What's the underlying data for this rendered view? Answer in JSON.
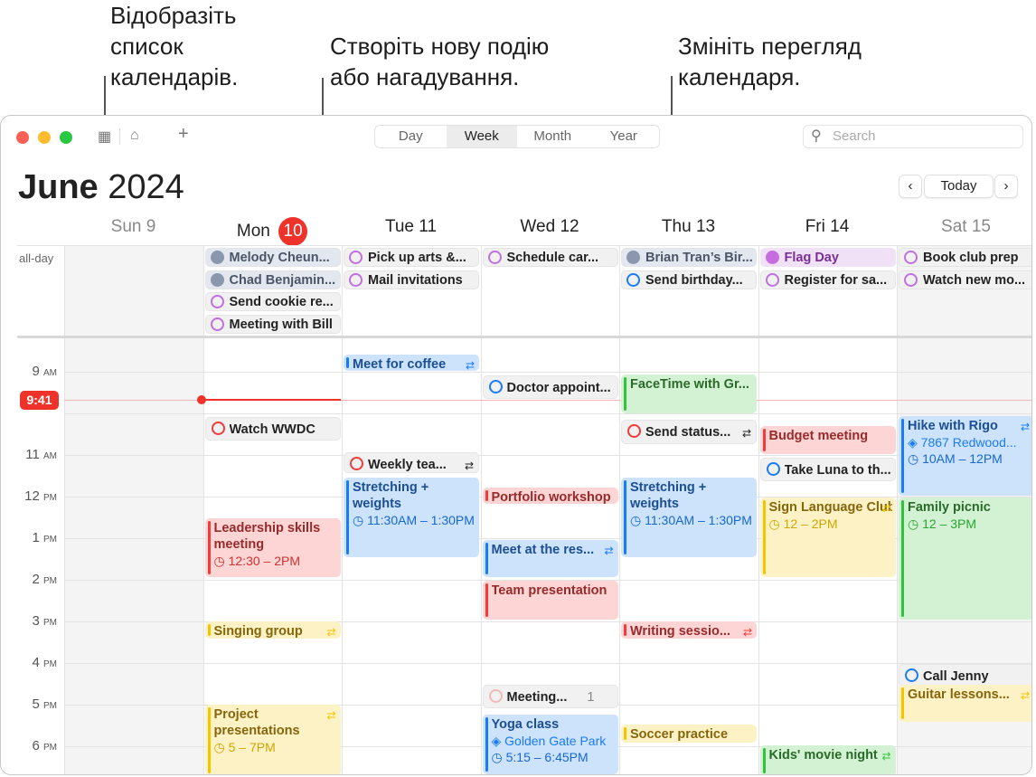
{
  "callouts": {
    "calendars": "Відобразіть\nсписок\nкалендарів.",
    "new_event": "Створіть нову подію\nабо нагадування.",
    "change_view": "Змініть перегляд\nкалендаря."
  },
  "toolbar": {
    "views": [
      "Day",
      "Week",
      "Month",
      "Year"
    ],
    "selected_view": "Week",
    "search_placeholder": "Search",
    "icons": [
      "calendar-list-icon",
      "inbox-icon",
      "plus-icon"
    ]
  },
  "header": {
    "month": "June",
    "year": "2024",
    "today_label": "Today",
    "prev": "‹",
    "next": "›"
  },
  "days": [
    {
      "name": "Sun",
      "num": "9"
    },
    {
      "name": "Mon",
      "num": "10",
      "today": true
    },
    {
      "name": "Tue",
      "num": "11"
    },
    {
      "name": "Wed",
      "num": "12"
    },
    {
      "name": "Thu",
      "num": "13"
    },
    {
      "name": "Fri",
      "num": "14"
    },
    {
      "name": "Sat",
      "num": "15"
    }
  ],
  "allday_label": "all-day",
  "hours": [
    {
      "h": "9",
      "p": "AM"
    },
    {
      "h": "11",
      "p": "AM"
    },
    {
      "h": "12",
      "p": "PM"
    },
    {
      "h": "1",
      "p": "PM"
    },
    {
      "h": "2",
      "p": "PM"
    },
    {
      "h": "3",
      "p": "PM"
    },
    {
      "h": "4",
      "p": "PM"
    },
    {
      "h": "5",
      "p": "PM"
    },
    {
      "h": "6",
      "p": "PM"
    }
  ],
  "now": "9:41",
  "colors": {
    "blue": "#1a7cf5",
    "red": "#f23b3b",
    "yellow": "#f5c400",
    "green": "#2fc43a",
    "purple": "#c070e0",
    "today": "#f0332a"
  },
  "allday_events": [
    {
      "day": "Mon",
      "title": "Melody Cheun...",
      "kind": "birthday"
    },
    {
      "day": "Mon",
      "title": "Chad Benjamin...",
      "kind": "birthday"
    },
    {
      "day": "Mon",
      "title": "Send cookie re...",
      "kind": "reminder",
      "color": "purple"
    },
    {
      "day": "Mon",
      "title": "Meeting with Bill",
      "kind": "reminder",
      "color": "purple"
    },
    {
      "day": "Tue",
      "title": "Pick up arts &...",
      "kind": "reminder",
      "color": "purple"
    },
    {
      "day": "Tue",
      "title": "Mail invitations",
      "kind": "reminder",
      "color": "purple"
    },
    {
      "day": "Wed",
      "title": "Schedule car...",
      "kind": "reminder",
      "color": "purple"
    },
    {
      "day": "Thu",
      "title": "Brian Tran’s Bir...",
      "kind": "birthday"
    },
    {
      "day": "Thu",
      "title": "Send birthday...",
      "kind": "reminder",
      "color": "blue"
    },
    {
      "day": "Fri",
      "title": "Flag Day",
      "kind": "holiday"
    },
    {
      "day": "Fri",
      "title": "Register for sa...",
      "kind": "reminder",
      "color": "purple"
    },
    {
      "day": "Sat",
      "title": "Book club prep",
      "kind": "reminder",
      "color": "purple"
    },
    {
      "day": "Sat",
      "title": "Watch new mo...",
      "kind": "reminder",
      "color": "purple"
    }
  ],
  "events": [
    {
      "day": "Tue",
      "title": "Meet for coffee",
      "color": "blue",
      "repeat": true
    },
    {
      "day": "Wed",
      "title": "Doctor appoint...",
      "kind": "reminder",
      "color": "blue"
    },
    {
      "day": "Thu",
      "title": "FaceTime with Gr...",
      "color": "green"
    },
    {
      "day": "Mon",
      "title": "Watch WWDC",
      "kind": "reminder",
      "color": "red"
    },
    {
      "day": "Thu",
      "title": "Send status...",
      "kind": "reminder",
      "color": "red",
      "repeat": true
    },
    {
      "day": "Fri",
      "title": "Budget meeting",
      "color": "red"
    },
    {
      "day": "Sat",
      "title": "Hike with Rigo",
      "color": "blue",
      "location": "7867 Redwood...",
      "time": "10AM – 12PM",
      "repeat": true
    },
    {
      "day": "Tue",
      "title": "Weekly tea...",
      "kind": "reminder",
      "color": "red",
      "repeat": true
    },
    {
      "day": "Fri",
      "title": "Take Luna to th...",
      "kind": "reminder",
      "color": "blue"
    },
    {
      "day": "Tue",
      "title": "Stretching + weights",
      "color": "blue",
      "time": "11:30AM – 1:30PM"
    },
    {
      "day": "Thu",
      "title": "Stretching + weights",
      "color": "blue",
      "time": "11:30AM – 1:30PM"
    },
    {
      "day": "Wed",
      "title": "Portfolio workshop",
      "color": "red"
    },
    {
      "day": "Fri",
      "title": "Sign Language Club",
      "color": "yellow",
      "time": "12 – 2PM",
      "repeat": true
    },
    {
      "day": "Sat",
      "title": "Family picnic",
      "color": "green",
      "time": "12 – 3PM"
    },
    {
      "day": "Mon",
      "title": "Leadership skills meeting",
      "color": "red",
      "time": "12:30 – 2PM"
    },
    {
      "day": "Wed",
      "title": "Meet at the res...",
      "color": "blue",
      "repeat": true
    },
    {
      "day": "Wed",
      "title": "Team presentation",
      "color": "red"
    },
    {
      "day": "Mon",
      "title": "Singing group",
      "color": "yellow",
      "repeat": true
    },
    {
      "day": "Thu",
      "title": "Writing sessio...",
      "color": "red",
      "repeat": true
    },
    {
      "day": "Sat",
      "title": "Call Jenny",
      "kind": "reminder",
      "color": "blue"
    },
    {
      "day": "Wed",
      "title": "Meeting...",
      "kind": "reminder",
      "color": "red",
      "more": "1 more"
    },
    {
      "day": "Sat",
      "title": "Guitar lessons...",
      "color": "yellow",
      "repeat": true
    },
    {
      "day": "Mon",
      "title": "Project presentations",
      "color": "yellow",
      "time": "5 – 7PM",
      "repeat": true
    },
    {
      "day": "Wed",
      "title": "Yoga class",
      "color": "blue",
      "location": "Golden Gate Park",
      "time": "5:15 – 6:45PM"
    },
    {
      "day": "Thu",
      "title": "Soccer practice",
      "color": "yellow"
    },
    {
      "day": "Fri",
      "title": "Kids' movie night",
      "color": "green",
      "repeat": true
    }
  ]
}
